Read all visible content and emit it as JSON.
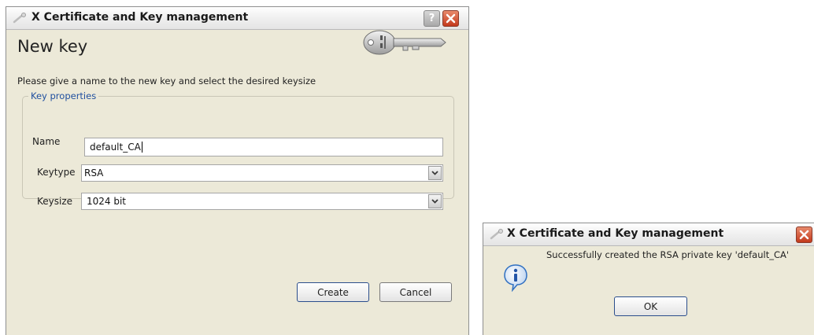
{
  "new_key_dialog": {
    "title": "X Certificate and Key management",
    "heading": "New key",
    "description": "Please give a name to the new key and select the desired keysize",
    "group_title": "Key properties",
    "name_label": "Name",
    "name_value": "default_CA",
    "keytype_label": "Keytype",
    "keytype_value": "RSA",
    "keysize_label": "Keysize",
    "keysize_value": "1024 bit",
    "create_label": "Create",
    "cancel_label": "Cancel",
    "help_glyph": "?"
  },
  "message_dialog": {
    "title": "X Certificate and Key management",
    "message": "Successfully created the RSA private key 'default_CA'",
    "ok_label": "OK"
  },
  "colors": {
    "window_bg": "#ece9d8",
    "group_title": "#1f4f9f",
    "close_button": "#c3391c",
    "info_icon": "#2f6fc1"
  },
  "icons": [
    "key-icon",
    "help-icon",
    "close-icon",
    "chevron-down-icon",
    "info-icon"
  ]
}
